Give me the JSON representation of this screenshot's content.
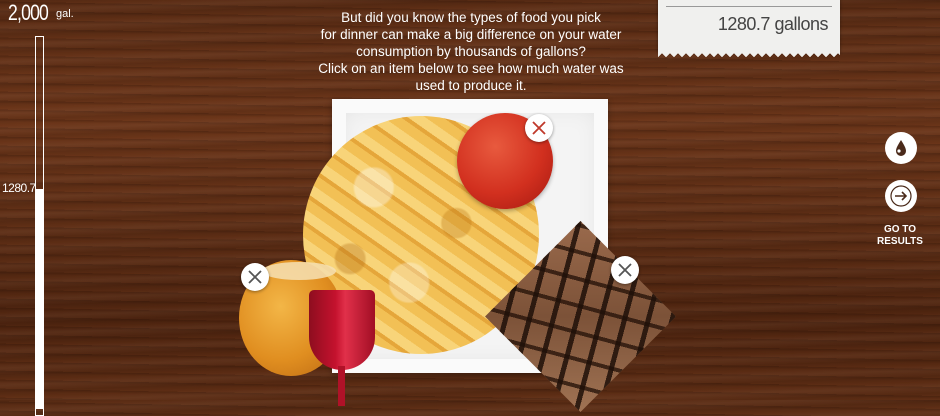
{
  "gauge": {
    "max_value": "2,000",
    "max_unit": "gal.",
    "current_value": "1280.7",
    "fill_fraction": 0.64
  },
  "intro": {
    "line1": "But did you know the types of food you pick",
    "line2": "for dinner can make a big difference on your water",
    "line3": "consumption by thousands of gallons?",
    "line4": "Click on an item below to see how much water was",
    "line5": "used to produce it."
  },
  "receipt": {
    "total": "1280.7 gallons"
  },
  "items": [
    {
      "name": "pasta",
      "icon": "pasta-image"
    },
    {
      "name": "tomato sauce",
      "icon": "sauce-image"
    },
    {
      "name": "steak",
      "icon": "steak-image"
    },
    {
      "name": "beer",
      "icon": "beer-image"
    },
    {
      "name": "wine",
      "icon": "wine-image"
    }
  ],
  "controls": {
    "info_icon": "water-drop-icon",
    "next_icon": "arrow-right-icon",
    "results_label_line1": "GO TO",
    "results_label_line2": "RESULTS"
  },
  "colors": {
    "wood": "#5e2e15",
    "receipt": "#f0f0ee",
    "accent_white": "#ffffff"
  }
}
